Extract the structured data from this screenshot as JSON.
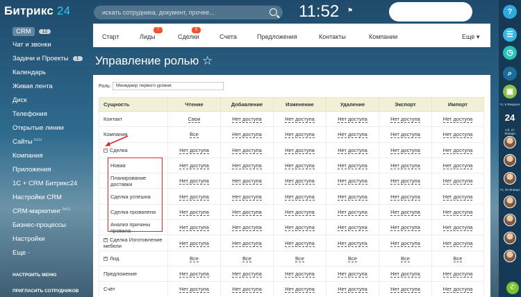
{
  "header": {
    "logo_main": "Битрикс",
    "logo_num": "24",
    "search_placeholder": "искать сотрудника, документ, прочее...",
    "clock": "11:52",
    "flag_icon": "flag-icon"
  },
  "sidebar": {
    "crm_label": "CRM",
    "crm_count": "12",
    "items": [
      {
        "label": "Чат и звонки"
      },
      {
        "label": "Задачи и Проекты",
        "count": "1"
      },
      {
        "label": "Календарь"
      },
      {
        "label": "Живая лента"
      },
      {
        "label": "Диск"
      },
      {
        "label": "Телефония"
      },
      {
        "label": "Открытые линии"
      },
      {
        "label": "Сайты",
        "sup": "beta"
      },
      {
        "label": "Компания"
      },
      {
        "label": "Приложения"
      },
      {
        "label": "1С + CRM Битрикс24"
      },
      {
        "label": "Настройки CRM"
      },
      {
        "label": "CRM-маркетинг",
        "sup": "beta"
      },
      {
        "label": "Бизнес-процессы"
      },
      {
        "label": "Настройки"
      },
      {
        "label": "Еще ·"
      }
    ],
    "configure_menu": "НАСТРОИТЬ МЕНЮ",
    "invite": "ПРИГЛАСИТЬ СОТРУДНИКОВ"
  },
  "tabs": [
    {
      "label": "Старт"
    },
    {
      "label": "Лиды",
      "badge": "7"
    },
    {
      "label": "Сделки",
      "badge": "5"
    },
    {
      "label": "Счета"
    },
    {
      "label": "Предложения"
    },
    {
      "label": "Контакты"
    },
    {
      "label": "Компании"
    },
    {
      "label": "Еще ▾"
    }
  ],
  "page_title": "Управление ролью ☆",
  "role": {
    "label": "Роль:",
    "value": "Менеджер первого уровня"
  },
  "table": {
    "headers": [
      "Сущность",
      "Чтение",
      "Добавление",
      "Изменение",
      "Удаление",
      "Экспорт",
      "Импорт"
    ],
    "rows": [
      {
        "name": "Контакт",
        "cells": [
          "Свои",
          "Нет доступа",
          "Нет доступа",
          "Нет доступа",
          "Нет доступа",
          "Нет доступа"
        ]
      },
      {
        "name": "Компания",
        "cells": [
          "Все",
          "Нет доступа",
          "Нет доступа",
          "Нет доступа",
          "Нет доступа",
          "Нет доступа"
        ]
      },
      {
        "name": "Сделка",
        "toggle": "−",
        "cells": [
          "Нет доступа",
          "Нет доступа",
          "Нет доступа",
          "Нет доступа",
          "Нет доступа",
          "Нет доступа"
        ]
      },
      {
        "name": "Новая",
        "sub": true,
        "cells": [
          "Нет доступа",
          "Нет доступа",
          "Нет доступа",
          "Нет доступа",
          "Нет доступа",
          "Нет доступа"
        ]
      },
      {
        "name": "Планирование доставки",
        "sub": true,
        "cells": [
          "Нет доступа",
          "Нет доступа",
          "Нет доступа",
          "Нет доступа",
          "Нет доступа",
          "Нет доступа"
        ]
      },
      {
        "name": "Сделка успешна",
        "sub": true,
        "cells": [
          "Нет доступа",
          "Нет доступа",
          "Нет доступа",
          "Нет доступа",
          "Нет доступа",
          "Нет доступа"
        ]
      },
      {
        "name": "Сделка провалена",
        "sub": true,
        "cells": [
          "Нет доступа",
          "Нет доступа",
          "Нет доступа",
          "Нет доступа",
          "Нет доступа",
          "Нет доступа"
        ]
      },
      {
        "name": "Анализ причины провала",
        "sub": true,
        "cells": [
          "Нет доступа",
          "Нет доступа",
          "Нет доступа",
          "Нет доступа",
          "Нет доступа",
          "Нет доступа"
        ]
      },
      {
        "name": "Сделка Изготовление мебели",
        "toggle": "+",
        "cells": [
          "Нет доступа",
          "Нет доступа",
          "Нет доступа",
          "Нет доступа",
          "Нет доступа",
          "Нет доступа"
        ]
      },
      {
        "name": "Лид",
        "toggle": "+",
        "cells": [
          "Все",
          "Все",
          "Все",
          "Все",
          "Все",
          "Все"
        ]
      },
      {
        "name": "Предложение",
        "cells": [
          "Нет доступа",
          "Нет доступа",
          "Нет доступа",
          "Нет доступа",
          "Нет доступа",
          "Нет доступа"
        ]
      },
      {
        "name": "Счёт",
        "cells": [
          "Нет доступа",
          "Нет доступа",
          "Нет доступа",
          "Нет доступа",
          "Нет доступа",
          "Нет доступа"
        ]
      }
    ]
  },
  "rightbar": {
    "help": "?",
    "date1": "Чт, 9 Февраля",
    "day": "24",
    "date2": "Сб, 27 Января",
    "date3": "Пт, 26 Января"
  },
  "colors": {
    "badge": "#f14f2f",
    "highlight": "#e0262c",
    "header_bg": "#f3f0d8"
  }
}
